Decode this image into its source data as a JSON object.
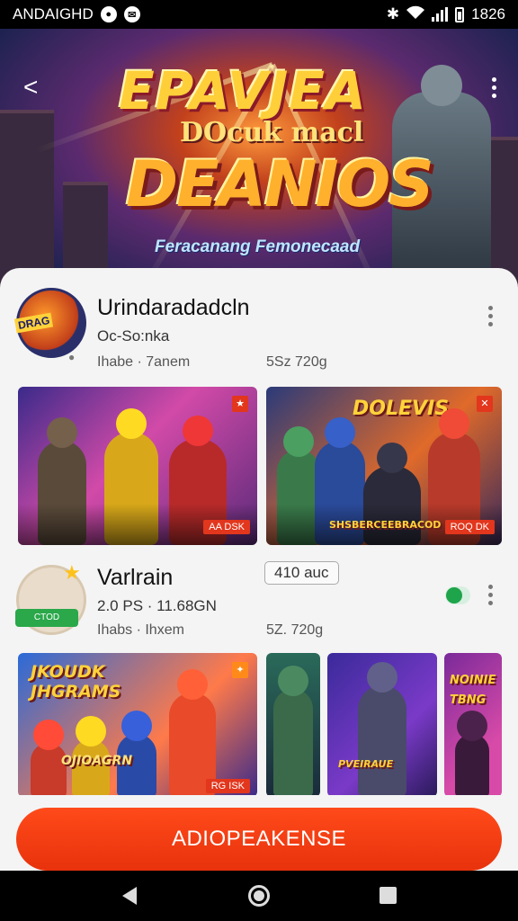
{
  "status_bar": {
    "carrier": "ANDAIGHD",
    "time": "1826",
    "icons": [
      "notification-icon",
      "notification-icon",
      "bluetooth-icon",
      "wifi-icon",
      "signal-icon",
      "battery-icon"
    ]
  },
  "hero": {
    "logo_title": "EPAVJEA",
    "logo_subtitle": "DOcuk macl",
    "logo_main": "DEANIOS",
    "logo_tagline": "Feracanang Femonecaad"
  },
  "apps": [
    {
      "name": "Urindaradadcln",
      "subtitle": "Oc-So:nka",
      "meta": "Ihabe · 7anem",
      "size": "5Sz 720g",
      "icon_text": "DRAG",
      "screenshots": [
        {
          "chip": "AA DSK"
        },
        {
          "title": "DOLEVIS",
          "caption": "SHSBERCEEBRACOD",
          "chip": "ROQ DK"
        }
      ]
    },
    {
      "name": "Varlrain",
      "price": "410 auc",
      "subtitle": "2.0 PS · 11.68GN",
      "meta": "Ihabs · Ihxem",
      "size": "5Z. 720g",
      "icon_text": "CTOD",
      "screenshots": [
        {
          "title": "JKOUDK JHGRAMS",
          "caption": "OJIOAGRN",
          "chip": "RG ISK"
        },
        {},
        {
          "caption": "PVEIRAUE"
        },
        {
          "title": "NOINIE TBNG"
        }
      ]
    }
  ],
  "install_label": "ADIOPEAKENSE",
  "colors": {
    "accent": "#E8320C",
    "sheet": "#F4F4F4",
    "toggle": "#1EA44A"
  }
}
